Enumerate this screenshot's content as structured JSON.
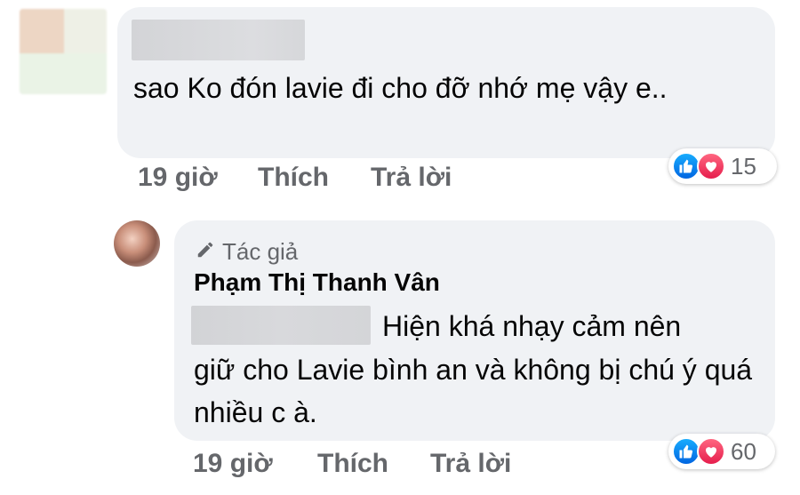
{
  "comment": {
    "text": "sao Ko đón lavie đi cho đỡ nhớ mẹ vậy e..",
    "time": "19 giờ",
    "like_label": "Thích",
    "reply_label": "Trả lời",
    "reaction_count": "15"
  },
  "reply": {
    "author_badge": "Tác giả",
    "author_name": "Phạm Thị Thanh Vân",
    "text_first": "Hiện khá nhạy cảm nên",
    "text_rest": "giữ cho Lavie bình an và không bị chú ý quá nhiều c à.",
    "time": "19 giờ",
    "like_label": "Thích",
    "reply_label": "Trả lời",
    "reaction_count": "60"
  },
  "icons": {
    "like": "thumbs-up-icon",
    "love": "heart-icon",
    "author": "pencil-icon"
  },
  "colors": {
    "bubble": "#f0f2f5",
    "meta_text": "#65676b",
    "like_blue": "#0165e1",
    "love_red": "#e61e4d"
  }
}
